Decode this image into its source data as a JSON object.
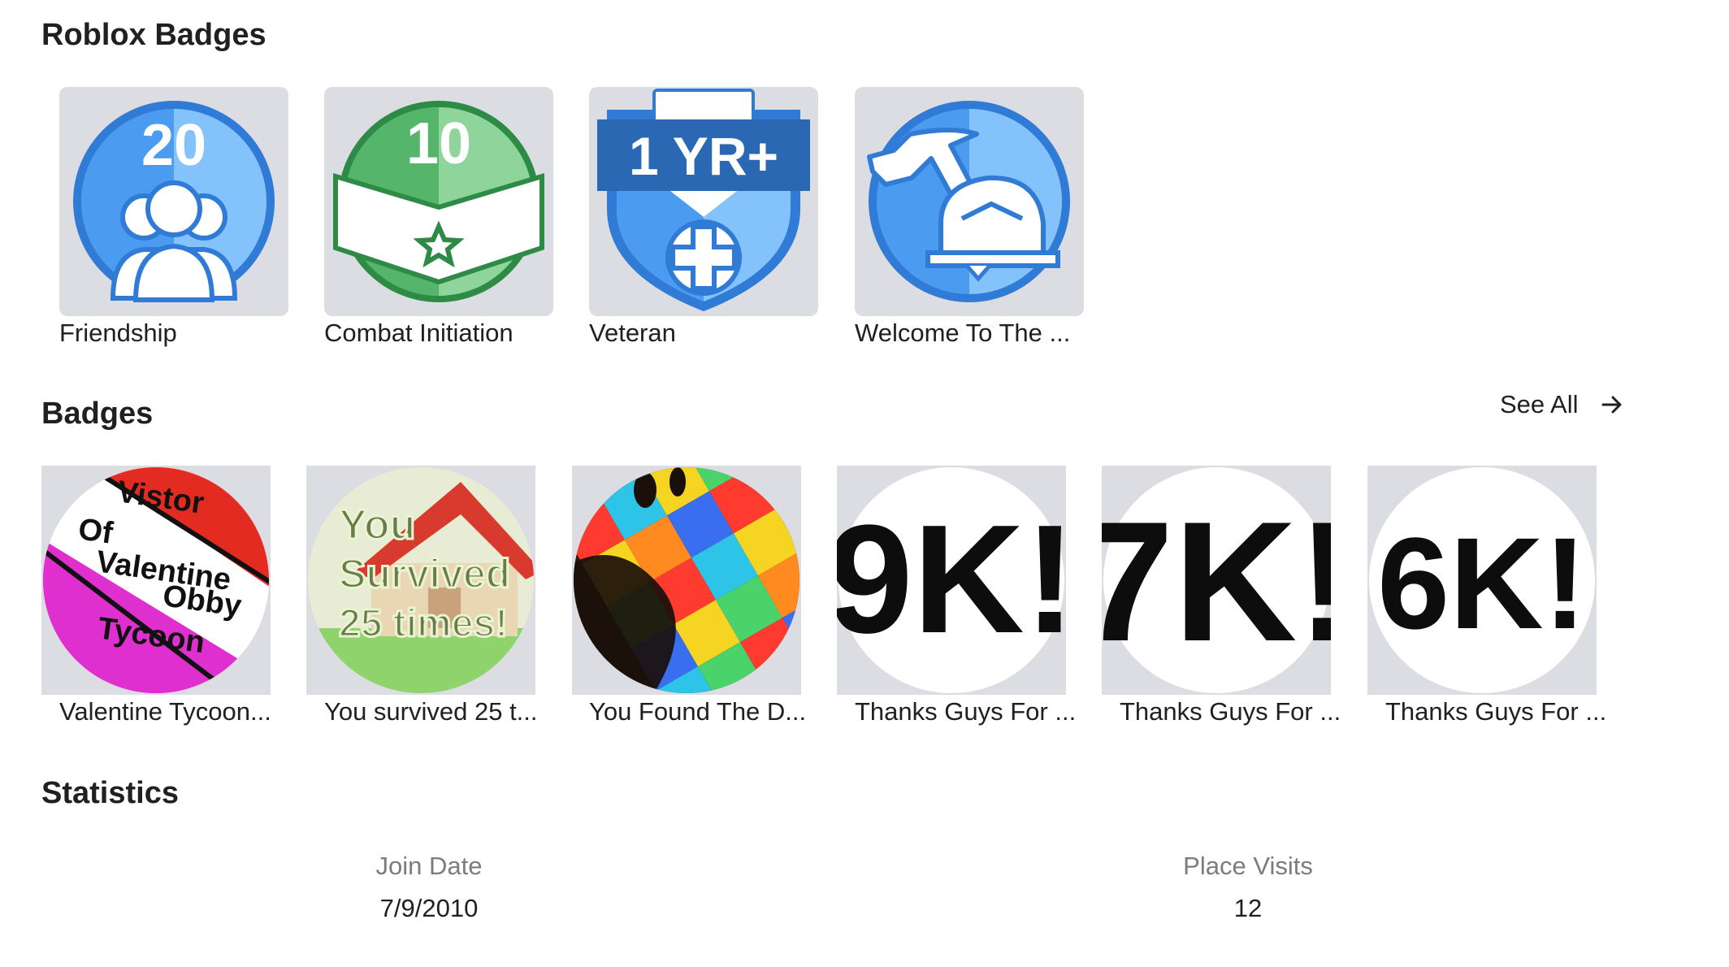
{
  "roblox_badges": {
    "title": "Roblox Badges",
    "items": [
      {
        "name": "Friendship",
        "art_text": "20"
      },
      {
        "name": "Combat Initiation",
        "art_text": "10"
      },
      {
        "name": "Veteran",
        "art_text": "1 YR+"
      },
      {
        "name": "Welcome To The ..."
      }
    ]
  },
  "badges": {
    "title": "Badges",
    "see_all": "See All",
    "items": [
      {
        "name": "Valentine Tycoon...",
        "art_lines": [
          "Vistor",
          "Of",
          "Valentine",
          "Obby",
          "Tycoon"
        ]
      },
      {
        "name": "You survived 25 t...",
        "art_lines": [
          "You",
          "Survived",
          "25 times!"
        ]
      },
      {
        "name": "You Found The D..."
      },
      {
        "name": "Thanks Guys For ...",
        "art_text": "9K!"
      },
      {
        "name": "Thanks Guys For ...",
        "art_text": "7K!"
      },
      {
        "name": "Thanks Guys For ...",
        "art_text": "6K!"
      }
    ]
  },
  "statistics": {
    "title": "Statistics",
    "join_date_label": "Join Date",
    "join_date_value": "7/9/2010",
    "place_visits_label": "Place Visits",
    "place_visits_value": "12"
  },
  "colors": {
    "tile_bg": "#dcdde2",
    "badge_blue": "#4a9df0",
    "badge_green": "#4fb565",
    "muted_text": "#7b7c80"
  }
}
